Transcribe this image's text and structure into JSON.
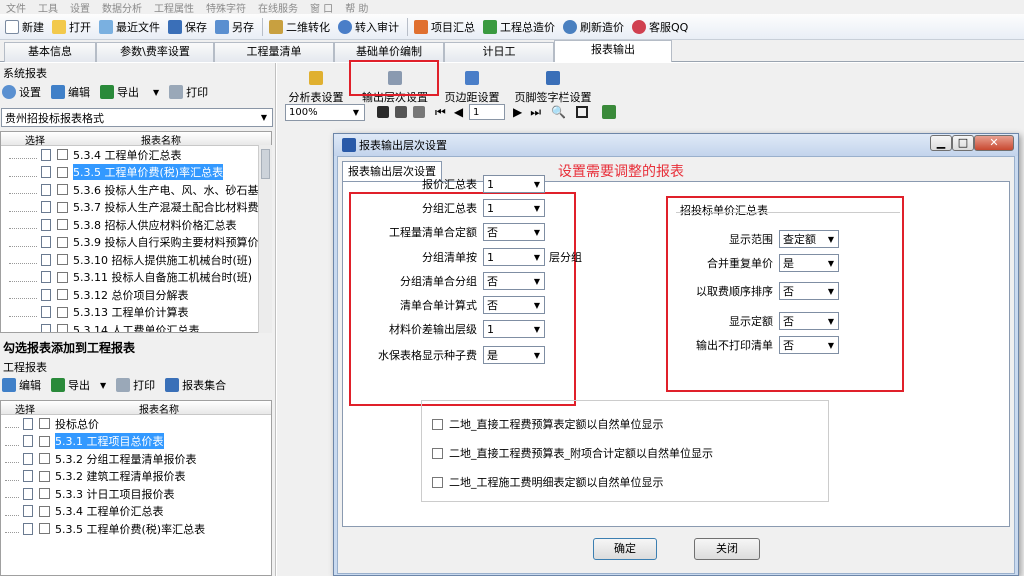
{
  "menu": [
    "文件",
    "工具",
    "设置",
    "数据分析",
    "工程属性",
    "特殊字符",
    "在线服务",
    "窗 口",
    "帮 助"
  ],
  "toolbar": [
    "新建",
    "打开",
    "最近文件",
    "保存",
    "另存",
    "二维转化",
    "转入审计",
    "项目汇总",
    "工程总造价",
    "刷新造价",
    "客服QQ"
  ],
  "main_tabs": [
    "基本信息",
    "参数\\费率设置",
    "工程量清单",
    "基础单价编制",
    "计日工",
    "报表输出"
  ],
  "left": {
    "sys_title": "系统报表",
    "sys_buttons": [
      "设置",
      "编辑",
      "导出",
      "打印"
    ],
    "template": "贵州招投标报表格式",
    "col_select": "选择",
    "col_name": "报表名称",
    "sys_rows": [
      "5.3.4 工程单价汇总表",
      "5.3.5 工程单价费(税)率汇总表",
      "5.3.6 投标人生产电、风、水、砂石基",
      "5.3.7 投标人生产混凝土配合比材料费",
      "5.3.8 招标人供应材料价格汇总表",
      "5.3.9 投标人自行采购主要材料预算价",
      "5.3.10 招标人提供施工机械台时(班)",
      "5.3.11 投标人自备施工机械台时(班)",
      "5.3.12 总价项目分解表",
      "5.3.13 工程单价计算表",
      "5.3.14 人工费单价汇总表"
    ],
    "sys_selected": 1,
    "add_title": "勾选报表添加到工程报表",
    "proj_title": "工程报表",
    "proj_buttons": [
      "编辑",
      "导出",
      "打印",
      "报表集合"
    ],
    "proj_rows": [
      "投标总价",
      "5.3.1 工程项目总价表",
      "5.3.2 分组工程量清单报价表",
      "5.3.2 建筑工程清单报价表",
      "5.3.3 计日工项目报价表",
      "5.3.4 工程单价汇总表",
      "5.3.5 工程单价费(税)率汇总表"
    ],
    "proj_selected": 1
  },
  "report_toolbar": [
    "分析表设置",
    "输出层次设置",
    "页边距设置",
    "页脚签字栏设置"
  ],
  "nav": {
    "zoom": "100%",
    "page": "1"
  },
  "dialog": {
    "title": "报表输出层次设置",
    "tab": "报表输出层次设置",
    "annotation": "设置需要调整的报表",
    "annotation_color": "#e8303a",
    "left_fields": [
      {
        "label": "报价汇总表",
        "value": "1"
      },
      {
        "label": "分组汇总表",
        "value": "1"
      },
      {
        "label": "工程量清单合定额",
        "value": "否"
      },
      {
        "label": "分组清单按",
        "value": "1",
        "suffix": "层分组"
      },
      {
        "label": "分组清单合分组",
        "value": "否"
      },
      {
        "label": "清单合单计算式",
        "value": "否"
      },
      {
        "label": "材料价差输出层级",
        "value": "1"
      },
      {
        "label": "水保表格显示种子费",
        "value": "是"
      }
    ],
    "group_title": "招投标单价汇总表",
    "right_fields": [
      {
        "label": "显示范围",
        "value": "查定额"
      },
      {
        "label": "合并重复单价",
        "value": "是"
      },
      {
        "label": "以取费顺序排序",
        "value": "否"
      },
      {
        "label": "显示定额",
        "value": "否"
      },
      {
        "label": "输出不打印清单",
        "value": "否"
      }
    ],
    "checkboxes": [
      "二地_直接工程费预算表定额以自然单位显示",
      "二地_直接工程费预算表_附项合计定额以自然单位显示",
      "二地_工程施工费明细表定额以自然单位显示"
    ],
    "ok": "确定",
    "close": "关闭"
  },
  "highlight_color": "#e0202a"
}
